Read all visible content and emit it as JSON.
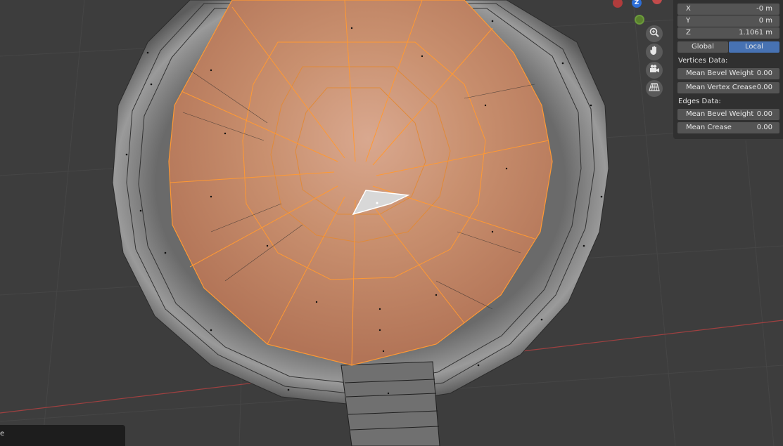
{
  "gizmo": {
    "z_label": "Z"
  },
  "panel": {
    "transform": [
      {
        "label": "X",
        "value": "-0 m"
      },
      {
        "label": "Y",
        "value": "0 m"
      },
      {
        "label": "Z",
        "value": "1.1061 m"
      }
    ],
    "space_toggle": {
      "global_label": "Global",
      "local_label": "Local",
      "active": "Local"
    },
    "vertices_heading": "Vertices Data:",
    "vertices": [
      {
        "label": "Mean Bevel Weight",
        "value": "0.00"
      },
      {
        "label": "Mean Vertex Crease",
        "value": "0.00"
      }
    ],
    "edges_heading": "Edges Data:",
    "edges": [
      {
        "label": "Mean Bevel Weight",
        "value": "0.00"
      },
      {
        "label": "Mean Crease",
        "value": "0.00"
      }
    ]
  },
  "status": {
    "text": "e"
  },
  "colors": {
    "viewport_bg": "#3d3d3d",
    "selection": "#ff9933",
    "selected_face": "#c88a66",
    "active_toggle": "#4772b3",
    "x_axis": "#c24b4b",
    "y_axis": "#6b9a3b",
    "z_axis": "#2d6ed6"
  },
  "icons": [
    "zoom-icon",
    "hand-pan-icon",
    "camera-icon",
    "grid-perspective-icon"
  ]
}
